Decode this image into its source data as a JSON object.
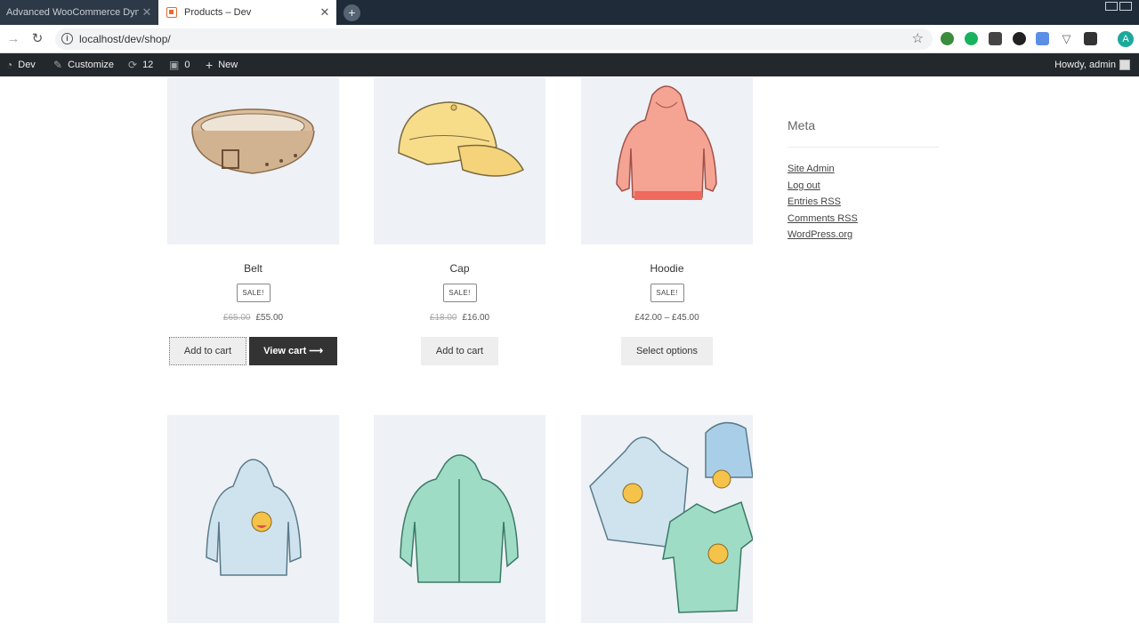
{
  "browser": {
    "tabs": [
      {
        "title": "Advanced WooCommerce Dyna",
        "active": false
      },
      {
        "title": "Products – Dev",
        "active": true
      }
    ],
    "url": "localhost/dev/shop/",
    "profile_initial": "A"
  },
  "adminbar": {
    "site": "Dev",
    "customize": "Customize",
    "updates": "12",
    "comments": "0",
    "new": "New",
    "howdy": "Howdy, admin"
  },
  "products": [
    {
      "name": "Belt",
      "sale": "SALE!",
      "old_price": "£65.00",
      "price": "£55.00",
      "buttons": [
        "Add to cart",
        "View cart"
      ]
    },
    {
      "name": "Cap",
      "sale": "SALE!",
      "old_price": "£18.00",
      "price": "£16.00",
      "buttons": [
        "Add to cart"
      ]
    },
    {
      "name": "Hoodie",
      "sale": "SALE!",
      "old_price": "",
      "price": "£42.00 – £45.00",
      "buttons": [
        "Select options"
      ]
    },
    {
      "name": "",
      "image": "hoodie-with-logo"
    },
    {
      "name": "",
      "image": "hoodie-with-zipper"
    },
    {
      "name": "",
      "image": "logo-collection"
    }
  ],
  "sidebar": {
    "meta_title": "Meta",
    "links": [
      "Site Admin",
      "Log out",
      "Entries RSS",
      "Comments RSS",
      "WordPress.org"
    ]
  },
  "colors": {
    "adminbar_bg": "#23282d",
    "tabbar_bg": "#1f2b39",
    "thumb_bg": "#eef1f5",
    "view_cart_bg": "#333333"
  }
}
